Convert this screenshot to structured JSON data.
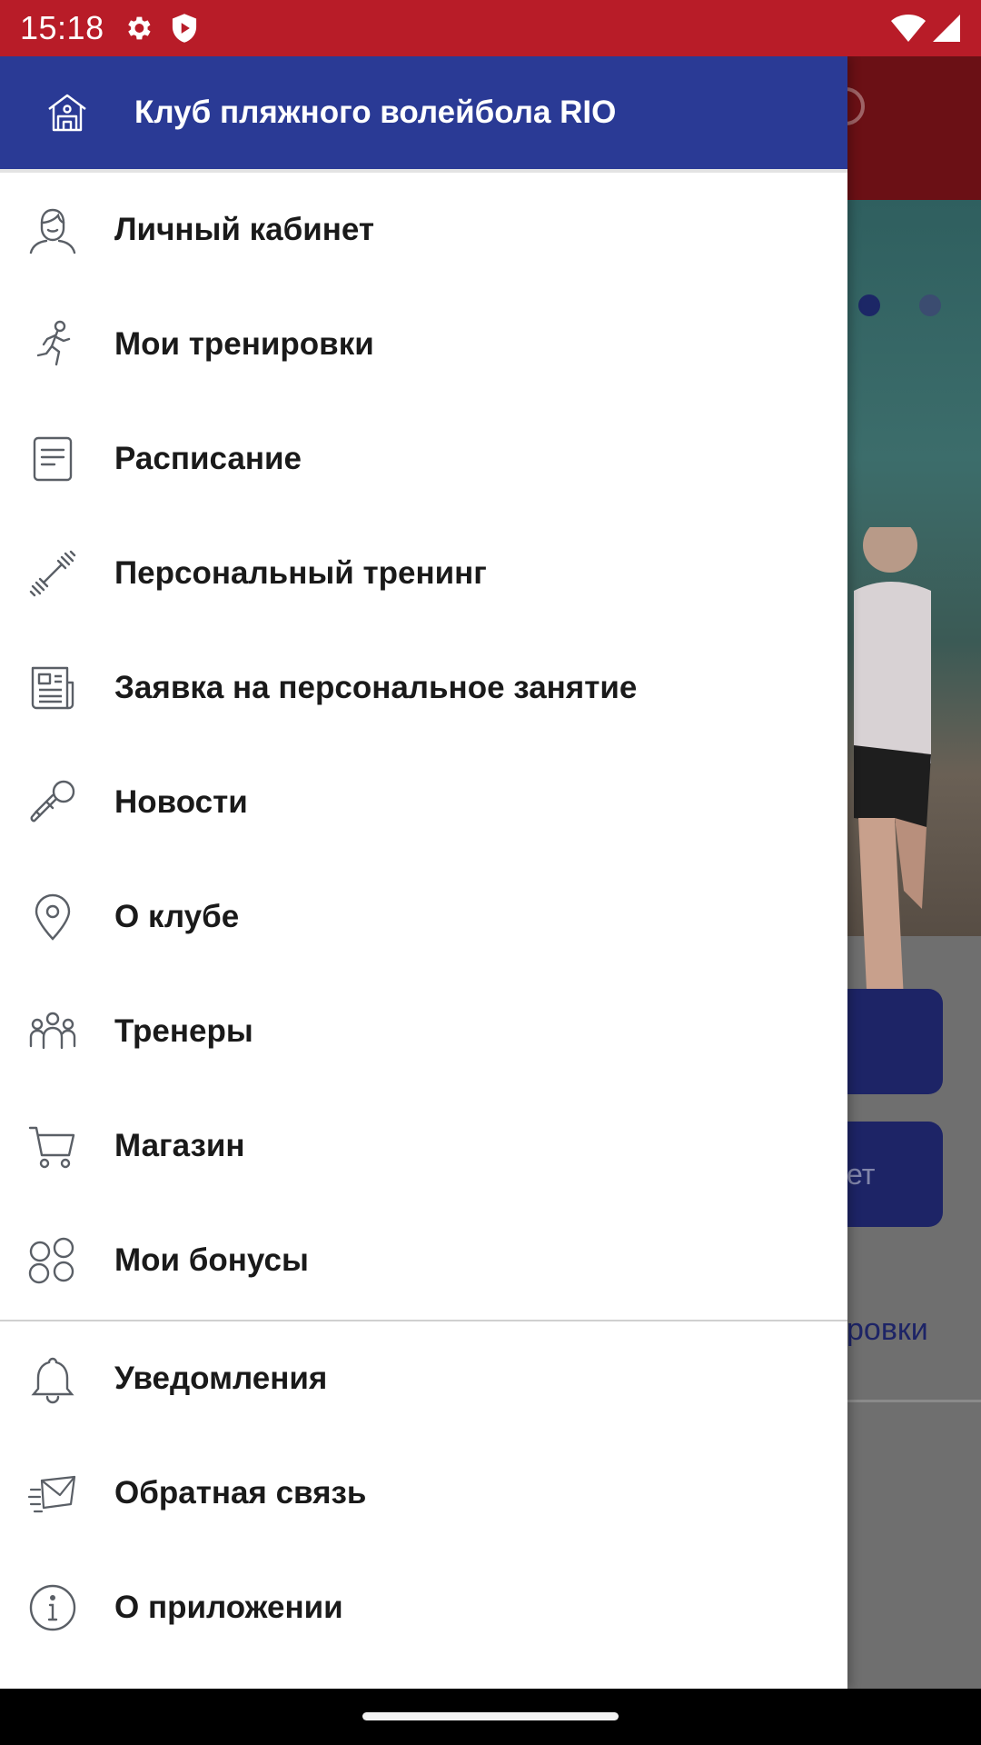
{
  "status_bar": {
    "time": "15:18",
    "icons": [
      "settings-icon",
      "shield-icon",
      "wifi-icon",
      "signal-icon"
    ]
  },
  "drawer": {
    "title": "Клуб пляжного волейбола RIO",
    "items": [
      {
        "label": "Личный кабинет",
        "icon": "user-icon"
      },
      {
        "label": "Мои тренировки",
        "icon": "runner-icon"
      },
      {
        "label": "Расписание",
        "icon": "document-icon"
      },
      {
        "label": "Персональный тренинг",
        "icon": "dumbbell-icon"
      },
      {
        "label": "Заявка на персональное занятие",
        "icon": "newspaper-icon"
      },
      {
        "label": "Новости",
        "icon": "microphone-icon"
      },
      {
        "label": "О клубе",
        "icon": "location-pin-icon"
      },
      {
        "label": "Тренеры",
        "icon": "group-icon"
      },
      {
        "label": "Магазин",
        "icon": "cart-icon"
      },
      {
        "label": "Мои бонусы",
        "icon": "bonus-circles-icon"
      }
    ],
    "secondary_items": [
      {
        "label": "Уведомления",
        "icon": "bell-icon"
      },
      {
        "label": "Обратная связь",
        "icon": "mail-send-icon"
      },
      {
        "label": "О приложении",
        "icon": "info-icon"
      }
    ]
  },
  "background_app": {
    "button_2_partial": "ет",
    "tab_partial": "ровки"
  },
  "colors": {
    "status_bar": "#b81c28",
    "drawer_header": "#2a3a95",
    "icon_gray": "#5a5f66"
  }
}
